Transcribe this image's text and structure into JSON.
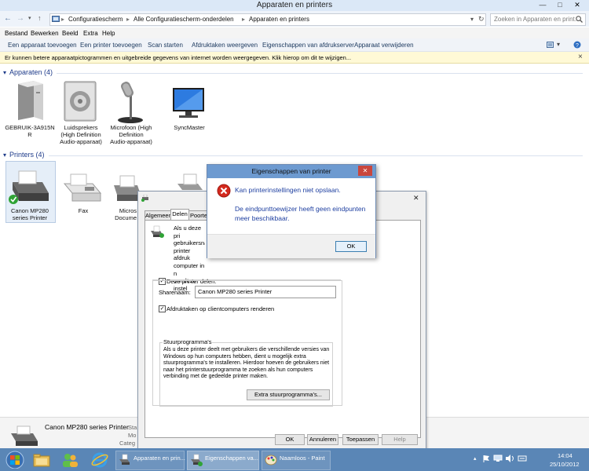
{
  "window": {
    "title": "Apparaten en printers",
    "minimize": "—",
    "maximize": "□",
    "close": "✕"
  },
  "address": {
    "breadcrumbs": [
      "Configuratiescherm",
      "Alle Configuratiescherm-onderdelen",
      "Apparaten en printers"
    ],
    "search_placeholder": "Zoeken in Apparaten en print..."
  },
  "menu": [
    "Bestand",
    "Bewerken",
    "Beeld",
    "Extra",
    "Help"
  ],
  "toolbar": [
    "Een apparaat toevoegen",
    "Een printer toevoegen",
    "Scan starten",
    "Afdruktaken weergeven",
    "Eigenschappen van afdrukserver",
    "Apparaat verwijderen"
  ],
  "infobar": {
    "text": "Er kunnen betere apparaatpictogrammen en uitgebreide gegevens van internet worden weergegeven. Klik hierop om dit te wijzigen...",
    "close": "×"
  },
  "devices": {
    "header": "Apparaten (4)",
    "items": [
      {
        "label": "GEBRUIK-3A915N\nR"
      },
      {
        "label": "Luidsprekers\n(High Definition\nAudio-apparaat)"
      },
      {
        "label": "Microfoon (High\nDefinition\nAudio-apparaat)"
      },
      {
        "label": "SyncMaster"
      }
    ]
  },
  "printers": {
    "header": "Printers (4)",
    "items": [
      {
        "label": "Canon MP280\nseries Printer"
      },
      {
        "label": "Fax"
      },
      {
        "label": "Micros\nDocume"
      }
    ]
  },
  "prop_dialog": {
    "tabs": [
      "Algemeen",
      "Delen",
      "Poorte"
    ],
    "desc": "Als u deze pri\ngebruikersnaa\nprinter afdruk\ncomputer in n\nom deze instel",
    "share_check_label": "Deze printer delen:",
    "share_name_label": "Sharenaam:",
    "share_name_value": "Canon MP280 series Printer",
    "render_label": "Afdruktaken op clientcomputers renderen",
    "drivers_title": "Stuurprogramma's",
    "drivers_text": "Als u deze printer deelt met gebruikers die verschillende versies van Windows op hun computers hebben, dient u mogelijk extra stuurprogramma's te installeren. Hierdoor hoeven de gebruikers niet naar het printerstuurprogramma te zoeken als hun computers verbinding met de gedeelde printer maken.",
    "extra_button": "Extra stuurprogramma's...",
    "buttons": {
      "ok": "OK",
      "cancel": "Annuleren",
      "apply": "Toepassen",
      "help": "Help"
    },
    "close": "✕"
  },
  "error_dialog": {
    "title": "Eigenschappen van printer",
    "close": "✕",
    "main": "Kan printerinstellingen niet opslaan.",
    "detail": "De eindpunttoewijzer heeft geen eindpunten meer beschikbaar.",
    "ok": "OK"
  },
  "details_pane": {
    "name": "Canon MP280 series Printer",
    "labels": [
      "Sta",
      "Mo",
      "Categ"
    ]
  },
  "taskbar": {
    "items": [
      "Apparaten en prin...",
      "Eigenschappen va...",
      "Naamloos - Paint"
    ],
    "time": "14:04",
    "date": "25/10/2012"
  }
}
